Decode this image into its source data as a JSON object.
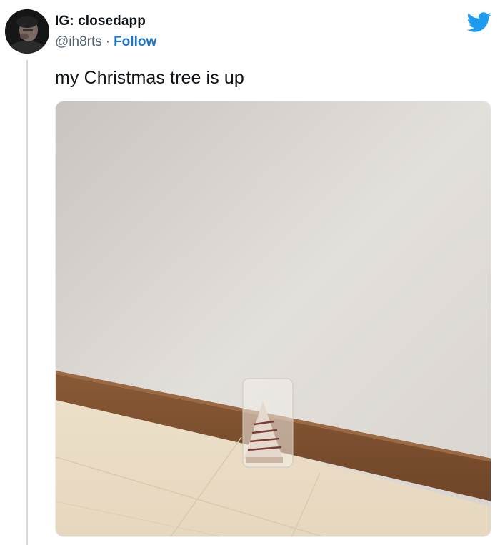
{
  "tweet": {
    "author": {
      "display_name": "IG: closedapp",
      "handle": "@ih8rts",
      "separator": "·",
      "follow_label": "Follow",
      "avatar_icon": "profile-photo-avatar"
    },
    "platform_icon": "twitter-bird-icon",
    "text": "my Christmas tree is up",
    "media": {
      "type": "photo",
      "subject": "small packaged tree-shaped snack cake on the floor against a wall"
    },
    "colors": {
      "follow_link": "#1d75c9",
      "twitter_blue": "#1d9bf0",
      "secondary_text": "#536471",
      "thread_line": "#cfd9de"
    }
  }
}
